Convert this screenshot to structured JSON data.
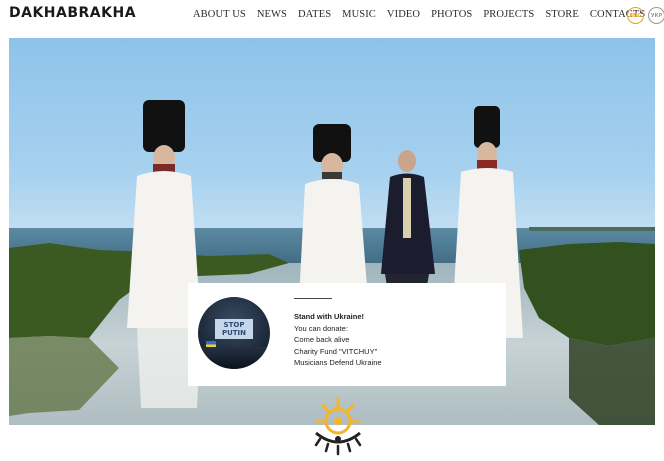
{
  "header": {
    "logo_text": "DAKHABRAKHA",
    "nav": [
      {
        "label": "ABOUT US"
      },
      {
        "label": "NEWS"
      },
      {
        "label": "DATES"
      },
      {
        "label": "MUSIC"
      },
      {
        "label": "VIDEO"
      },
      {
        "label": "PHOTOS"
      },
      {
        "label": "PROJECTS"
      },
      {
        "label": "STORE"
      },
      {
        "label": "CONTACTS"
      }
    ],
    "languages": [
      {
        "label": "ENG",
        "active": true,
        "color": "#e5a31e"
      },
      {
        "label": "УКР",
        "active": false,
        "color": "#9a9a9a"
      }
    ]
  },
  "hero": {
    "image": "band-on-beach-photo",
    "colors": {
      "sky": "#a7d1ef",
      "sea": "#4b7a93",
      "seaweed": "#3b5a22"
    }
  },
  "card": {
    "image_sign_text": "STOP PUTIN",
    "title": "Stand with Ukraine!",
    "lines": [
      "You can donate:",
      "Come back alive",
      "Charity Fund \"VITCHUY\"",
      "Musicians Defend Ukraine"
    ]
  },
  "footer": {
    "emblem_icon": "sun-emblem-icon"
  }
}
